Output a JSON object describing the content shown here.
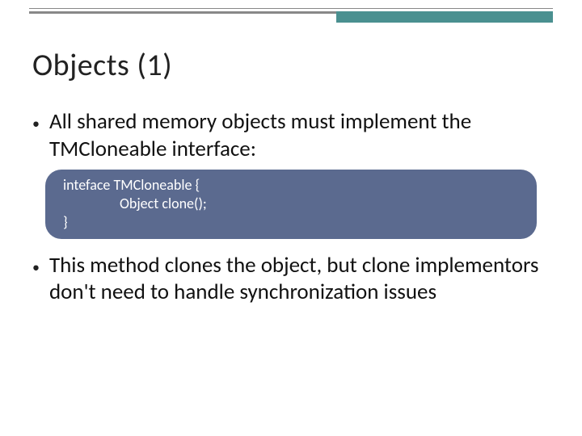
{
  "slide": {
    "title": "Objects (1)",
    "bullets": [
      "All shared memory objects must implement the TMCloneable interface:",
      "This method clones the object, but clone implementors don't need to handle synchronization issues"
    ],
    "code": {
      "line1": "inteface TMCloneable {",
      "line2": "Object clone();",
      "line3": "}"
    }
  }
}
